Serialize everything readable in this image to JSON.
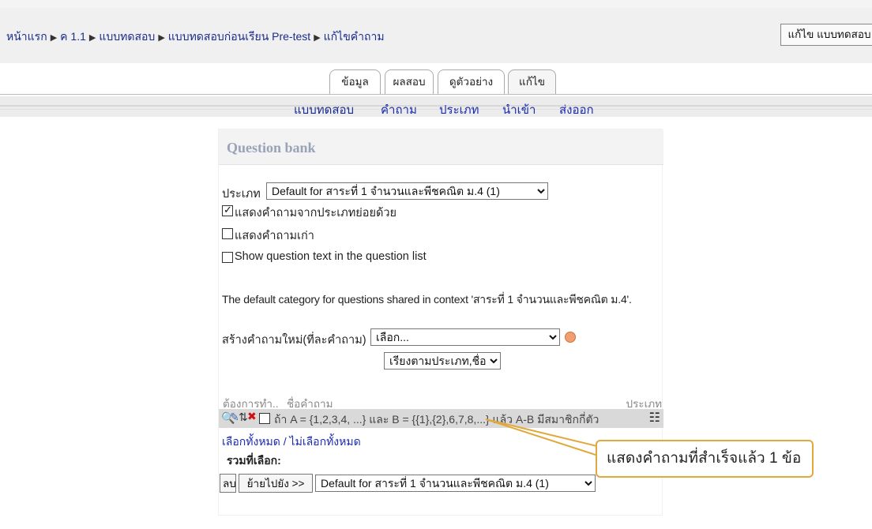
{
  "breadcrumb": {
    "home": "หน้าแรก",
    "course": "ค 1.1",
    "quizzes": "แบบทดสอบ",
    "quiz": "แบบทดสอบก่อนเรียน Pre-test",
    "current": "แก้ไขคำถาม",
    "separator": "▶"
  },
  "header": {
    "edit_button": "แก้ไข แบบทดสอบ"
  },
  "tabs": [
    {
      "label": "ข้อมูล"
    },
    {
      "label": "ผลสอบ"
    },
    {
      "label": "ดูตัวอย่าง"
    },
    {
      "label": "แก้ไข"
    }
  ],
  "subtabs": [
    {
      "label": "แบบทดสอบ"
    },
    {
      "label": "คำถาม"
    },
    {
      "label": "ประเภท"
    },
    {
      "label": "นำเข้า"
    },
    {
      "label": "ส่งออก"
    }
  ],
  "panel": {
    "title": "Question bank",
    "category_label": "ประเภท",
    "category_value": "Default for สาระที่ 1 จำนวนและพีชคณิต ม.4 (1)",
    "options": [
      {
        "label": "แสดงคำถามจากประเภทย่อยด้วย",
        "checked": true
      },
      {
        "label": "แสดงคำถามเก่า",
        "checked": false
      },
      {
        "label": "Show question text in the question list",
        "checked": false
      }
    ],
    "category_info": "The default category for questions shared in context 'สาระที่ 1 จำนวนและพีชคณิต ม.4'.",
    "create_label": "สร้างคำถามใหม่(ที่ละคำถาม)",
    "create_value": "เลือก...",
    "sort_value": "เรียงตามประเภท,ชื่อ",
    "table": {
      "col_action": "ต้องการทำ..",
      "col_name": "ชื่อคำถาม",
      "col_type": "ประเภท",
      "rows": [
        {
          "text": "ถ้า A = {1,2,3,4, ...} และ B = {{1},{2},6,7,8,...} แล้ว A-B มีสมาชิกกี่ตัว",
          "type_icon": "multichoice-icon"
        }
      ]
    },
    "select_all": "เลือกทั้งหมด",
    "select_sep": "/",
    "deselect_all": "ไม่เลือกทั้งหมด",
    "with_selected": "รวมที่เลือก:",
    "delete_button": "ลบ",
    "move_button": "ย้ายไปยัง >>",
    "move_target": "Default for สาระที่ 1 จำนวนและพีชคณิต ม.4 (1)"
  },
  "callout": {
    "text": "แสดงคำถามที่สำเร็จแล้ว 1 ข้อ"
  },
  "colors": {
    "link": "#1a2bb0",
    "callout_border": "#e0a93e",
    "panel_title": "#99a3b8",
    "selected_row": "#d9d9d9"
  }
}
